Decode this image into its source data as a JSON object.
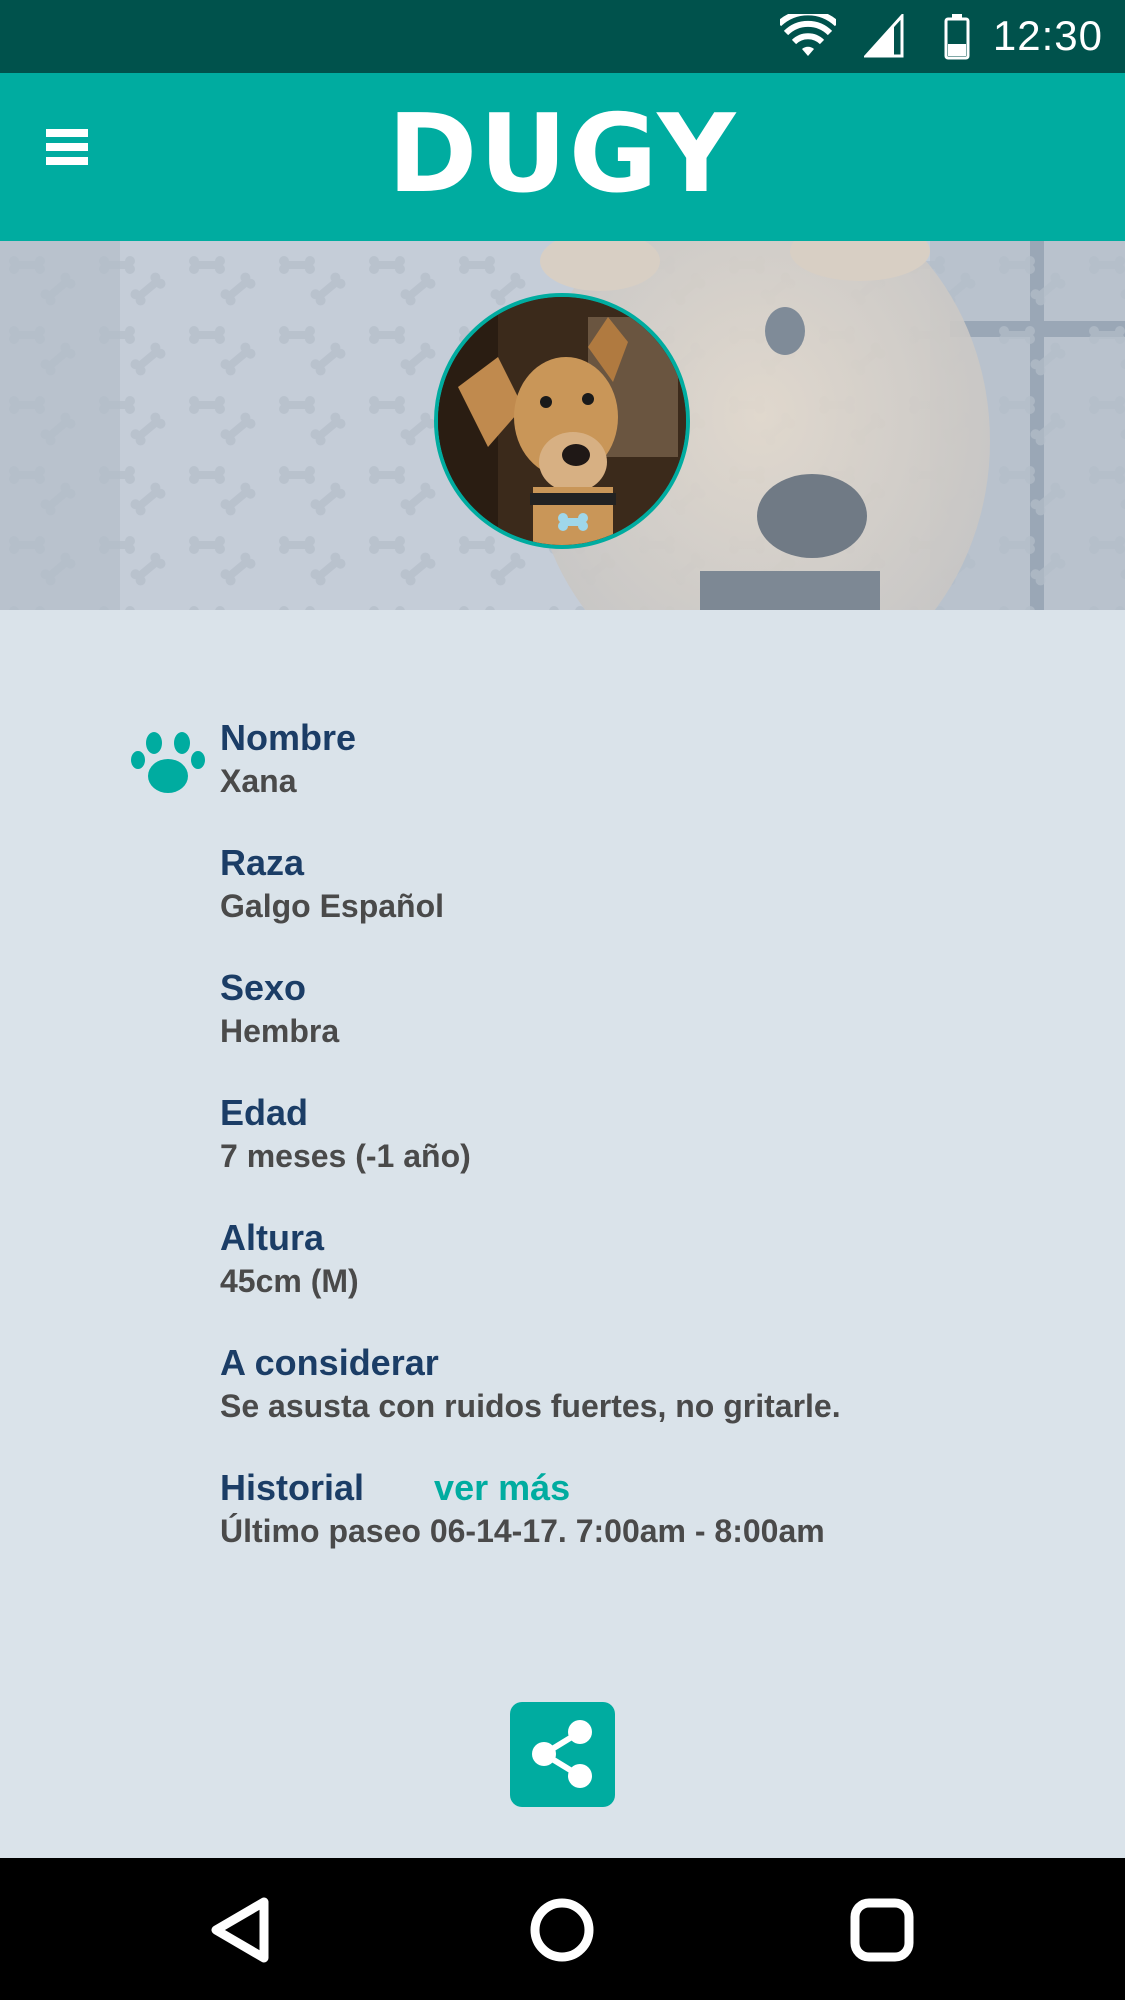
{
  "status_bar": {
    "time": "12:30",
    "icons": [
      "wifi-icon",
      "signal-icon",
      "battery-icon"
    ]
  },
  "app_bar": {
    "title": "DUGY",
    "menu_icon": "hamburger-menu-icon"
  },
  "colors": {
    "primary": "#00aca0",
    "status_bar": "#00524c",
    "label": "#1b3d66",
    "value": "#4a4a4a",
    "background": "#dae3ea"
  },
  "profile": {
    "icon": "paw-icon",
    "fields": [
      {
        "label": "Nombre",
        "value": "Xana"
      },
      {
        "label": "Raza",
        "value": "Galgo Español"
      },
      {
        "label": "Sexo",
        "value": "Hembra"
      },
      {
        "label": "Edad",
        "value": "7 meses (-1 año)"
      },
      {
        "label": "Altura",
        "value": "45cm (M)"
      },
      {
        "label": "A considerar",
        "value": "Se asusta con ruidos fuertes, no gritarle."
      }
    ],
    "history": {
      "label": "Historial",
      "link": "ver más",
      "value": "Último paseo 06-14-17. 7:00am - 8:00am"
    }
  },
  "actions": {
    "share_icon": "share-icon"
  },
  "nav_bar": {
    "buttons": [
      "back-icon",
      "home-icon",
      "recents-icon"
    ]
  }
}
